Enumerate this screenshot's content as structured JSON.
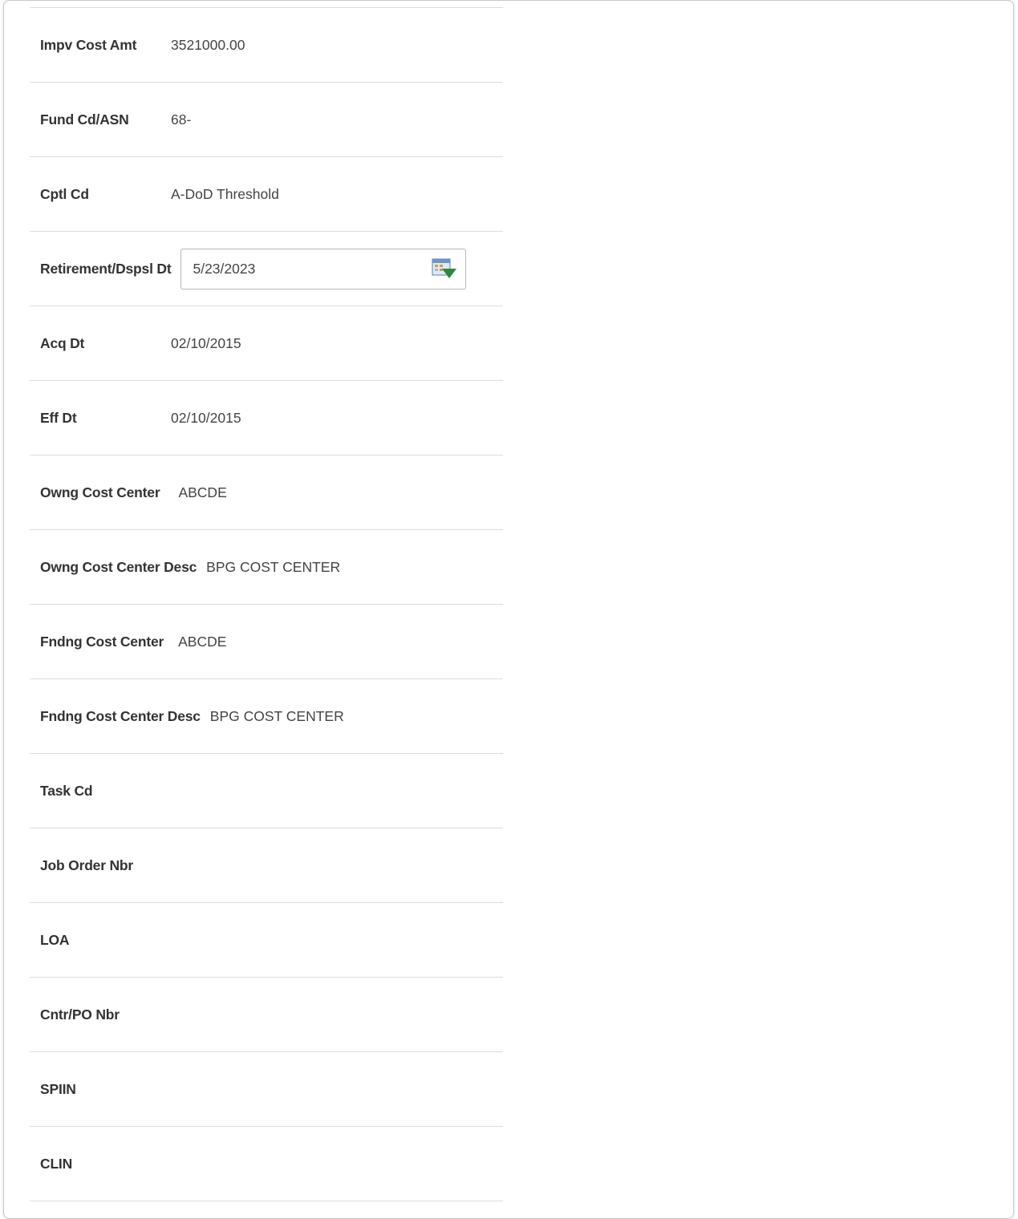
{
  "fields": [
    {
      "label": "Impv Cost Amt",
      "value": "3521000.00"
    },
    {
      "label": "Fund Cd/ASN",
      "value": "68-"
    },
    {
      "label": "Cptl Cd",
      "value": "A-DoD Threshold"
    },
    {
      "label": "Retirement/Dspsl Dt",
      "value": "5/23/2023",
      "type": "date-input",
      "icon": "calendar-icon"
    },
    {
      "label": "Acq Dt",
      "value": "02/10/2015"
    },
    {
      "label": "Eff Dt",
      "value": "02/10/2015"
    },
    {
      "label": "Owng Cost Center",
      "value": "ABCDE"
    },
    {
      "label": "Owng Cost Center Desc",
      "value": "BPG COST CENTER"
    },
    {
      "label": "Fndng Cost Center",
      "value": "ABCDE"
    },
    {
      "label": "Fndng Cost Center Desc",
      "value": "BPG COST CENTER"
    },
    {
      "label": "Task Cd",
      "value": ""
    },
    {
      "label": "Job Order Nbr",
      "value": ""
    },
    {
      "label": "LOA",
      "value": ""
    },
    {
      "label": "Cntr/PO Nbr",
      "value": ""
    },
    {
      "label": "SPIIN",
      "value": ""
    },
    {
      "label": "CLIN",
      "value": ""
    }
  ],
  "colors": {
    "label": "#333333",
    "value": "#444444",
    "divider": "#dcdcdc",
    "calendar_accent": "#2a8a3a"
  }
}
